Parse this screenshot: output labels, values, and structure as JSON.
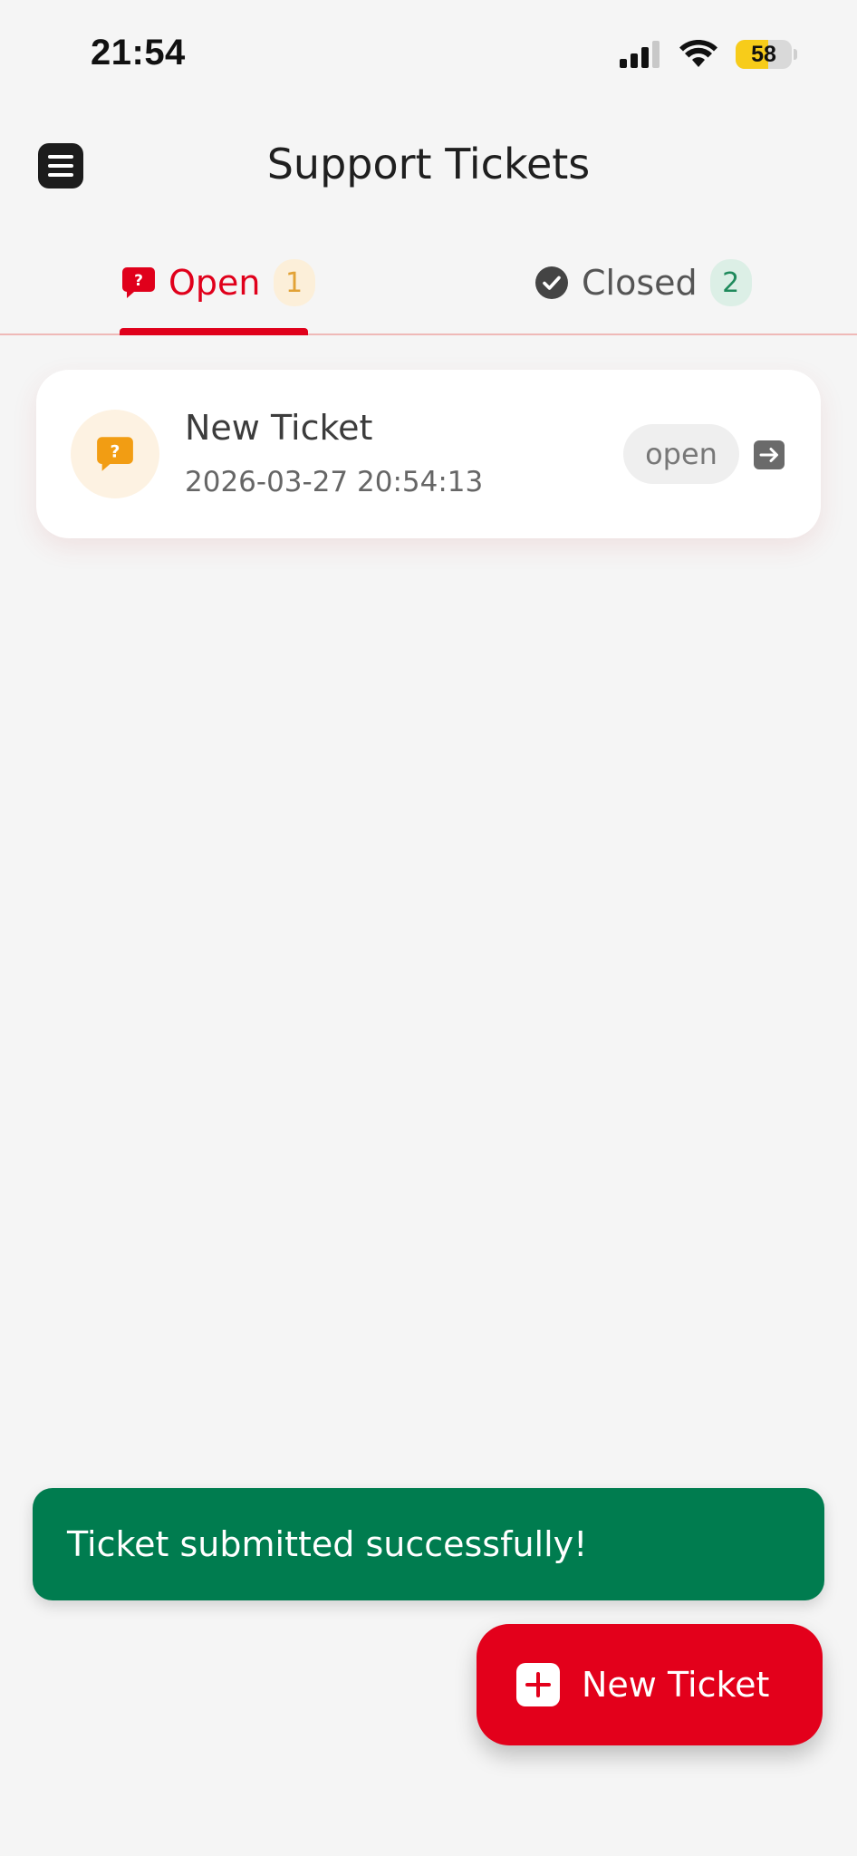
{
  "status_bar": {
    "time": "21:54",
    "battery_level": "58",
    "battery_fraction": 0.58
  },
  "header": {
    "title": "Support Tickets",
    "menu_icon": "hamburger-menu-icon"
  },
  "tabs": [
    {
      "label": "Open",
      "count": "1",
      "icon": "question-chat-icon",
      "active": true,
      "color": "#e0001b"
    },
    {
      "label": "Closed",
      "count": "2",
      "icon": "check-circle-icon",
      "active": false,
      "color": "#555555"
    }
  ],
  "tickets": [
    {
      "title": "New Ticket",
      "date": "2026-03-27 20:54:13",
      "status": "open",
      "icon": "question-chat-icon",
      "action_icon": "arrow-right-icon"
    }
  ],
  "toast": {
    "message": "Ticket submitted successfully!",
    "color": "#007c4f"
  },
  "fab": {
    "label": "New Ticket",
    "icon": "plus-icon",
    "color": "#e3001b"
  }
}
